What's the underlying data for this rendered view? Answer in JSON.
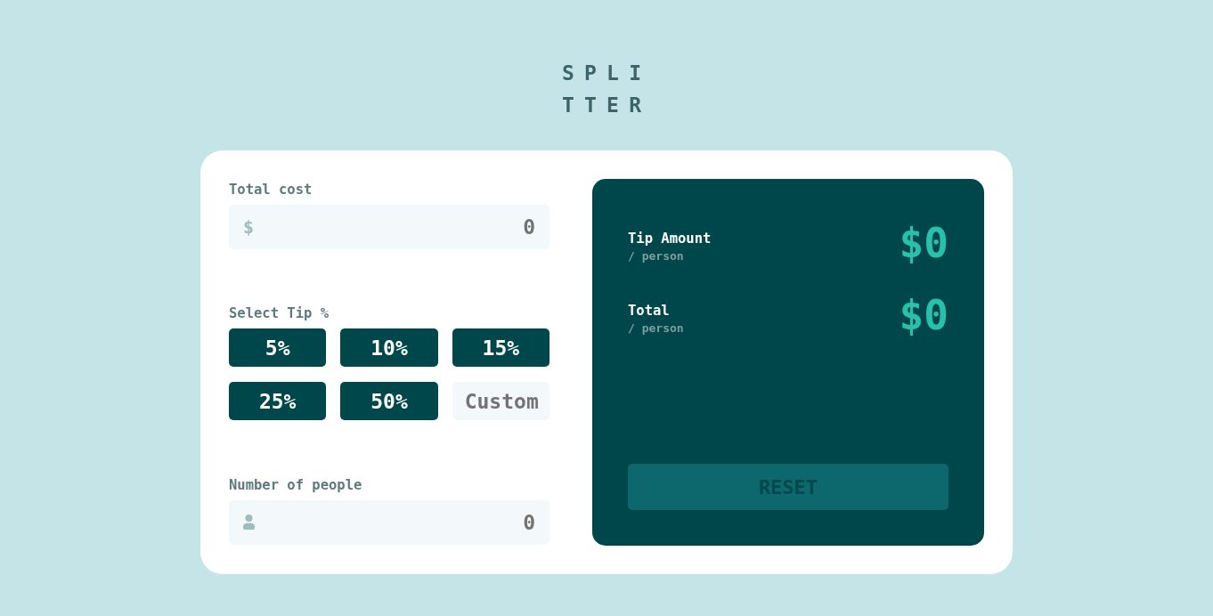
{
  "logo": {
    "text": "SPLITTER"
  },
  "bill": {
    "label": "Total cost",
    "prefix": "$",
    "placeholder": "0"
  },
  "tip": {
    "label": "Select Tip %",
    "options": [
      {
        "label": "5%",
        "selected": false
      },
      {
        "label": "10%",
        "selected": false
      },
      {
        "label": "15%",
        "selected": false
      },
      {
        "label": "25%",
        "selected": false
      },
      {
        "label": "50%",
        "selected": false
      }
    ],
    "custom": {
      "placeholder": "Custom"
    }
  },
  "people": {
    "label": "Number of people",
    "placeholder": "0"
  },
  "results": [
    {
      "label": "Tip Amount",
      "sublabel": "/ person",
      "amount": "$0"
    },
    {
      "label": "Total",
      "sublabel": "/ person",
      "amount": "$0"
    }
  ],
  "reset": {
    "label": "RESET",
    "disabled": true
  }
}
